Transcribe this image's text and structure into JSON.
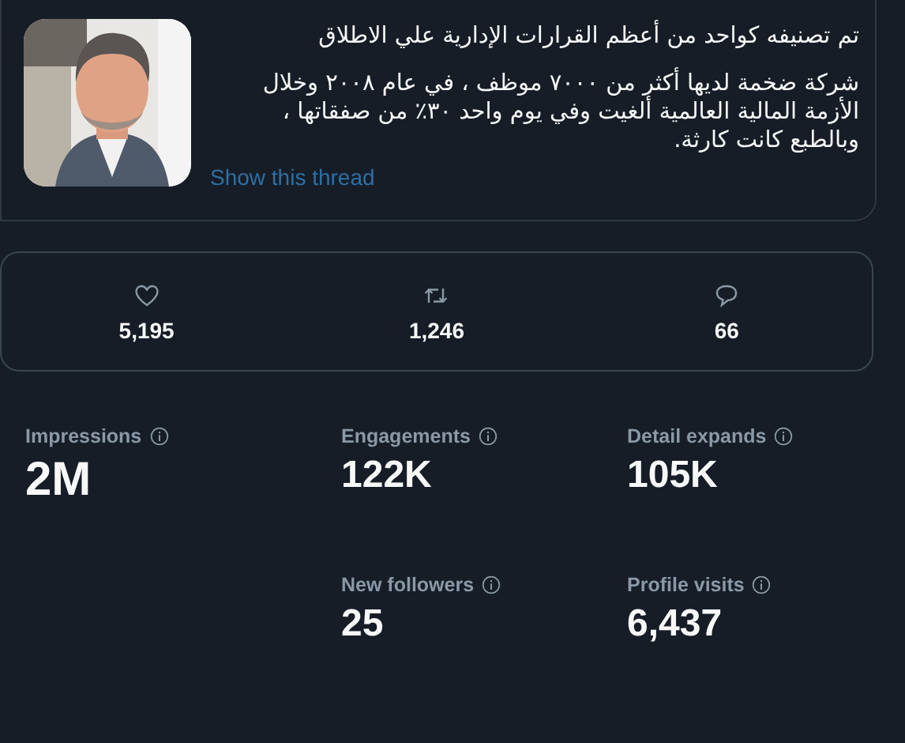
{
  "tweet": {
    "paragraphs": [
      "تم تصنيفه كواحد من أعظم القرارات الإدارية علي الاطلاق",
      "شركة ضخمة لديها أكثر من ٧٠٠٠ موظف ، في عام ٢٠٠٨ وخلال الأزمة المالية العالمية  ألغيت وفي يوم واحد ٣٠٪ من صفقاتها ، وبالطبع كانت كارثة."
    ],
    "media": {
      "kind": "picture"
    },
    "thread_link": "Show this thread"
  },
  "engagement": [
    {
      "kind": "like",
      "count": "5,195"
    },
    {
      "kind": "retweet",
      "count": "1,246"
    },
    {
      "kind": "reply",
      "count": "66"
    }
  ],
  "metrics": [
    {
      "label": "Impressions",
      "value": "2M",
      "kind": "headline"
    },
    {
      "label": "Engagements",
      "value": "122K",
      "kind": "regular"
    },
    {
      "label": "Detail expands",
      "value": "105K",
      "kind": "regular"
    },
    {
      "label": "New followers",
      "value": "25",
      "kind": "regular"
    },
    {
      "label": "Profile visits",
      "value": "6,437",
      "kind": "regular"
    }
  ]
}
